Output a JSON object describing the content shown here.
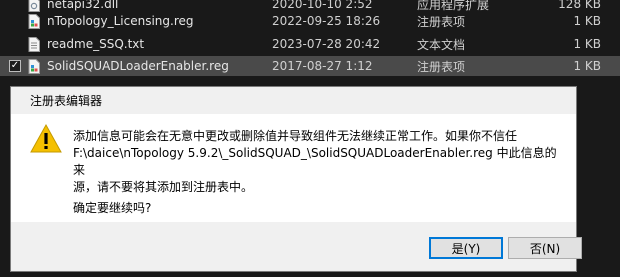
{
  "files": [
    {
      "name": "netapi32.dll",
      "date": "2020-10-10 2:52",
      "type": "应用程序扩展",
      "size": "128 KB",
      "icon": "dll-icon",
      "selected": false
    },
    {
      "name": "nTopology_Licensing.reg",
      "date": "2022-09-25 18:26",
      "type": "注册表项",
      "size": "1 KB",
      "icon": "reg-icon",
      "selected": false
    },
    {
      "name": "readme_SSQ.txt",
      "date": "2023-07-28 20:42",
      "type": "文本文档",
      "size": "1 KB",
      "icon": "txt-icon",
      "selected": false
    },
    {
      "name": "SolidSQUADLoaderEnabler.reg",
      "date": "2017-08-27 1:12",
      "type": "注册表项",
      "size": "1 KB",
      "icon": "reg-icon",
      "selected": true
    }
  ],
  "checkbox_mark": "✓",
  "dialog": {
    "title": "注册表编辑器",
    "message_line1": "添加信息可能会在无意中更改或删除值并导致组件无法继续正常工作。如果你不信任",
    "message_line2": "F:\\daice\\nTopology 5.9.2\\_SolidSQUAD_\\SolidSQUADLoaderEnabler.reg 中此信息的来",
    "message_line3": "源，请不要将其添加到注册表中。",
    "confirm": "确定要继续吗?",
    "yes_button": "是(Y)",
    "no_button": "否(N)",
    "icon": "warning-icon"
  },
  "colors": {
    "explorer_bg": "#191919",
    "selected_row": "#4a4a4a",
    "dialog_bg": "#f0f0f0",
    "warning_yellow": "#f5c000",
    "default_button_border": "#0078d7"
  }
}
